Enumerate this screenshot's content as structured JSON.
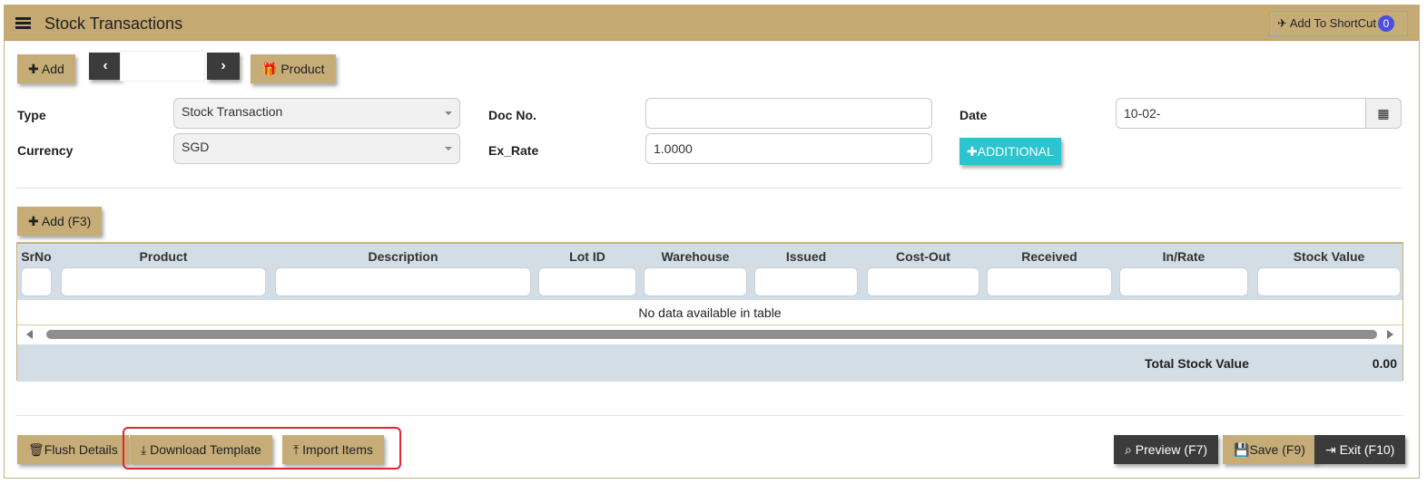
{
  "header": {
    "title": "Stock Transactions",
    "shortcut_label": "Add To ShortCut",
    "shortcut_count": "0"
  },
  "toolbar": {
    "add_label": "Add",
    "product_label": "Product",
    "nav_value": ""
  },
  "form": {
    "type_label": "Type",
    "type_value": "Stock Transaction",
    "currency_label": "Currency",
    "currency_value": "SGD",
    "doc_label": "Doc No.",
    "doc_value": "",
    "exrate_label": "Ex_Rate",
    "exrate_value": "1.0000",
    "date_label": "Date",
    "date_value": "10-02-",
    "additional_label": "ADDITIONAL"
  },
  "grid": {
    "add_label": "Add (F3)",
    "columns": [
      "SrNo",
      "Product",
      "Description",
      "Lot ID",
      "Warehouse",
      "Issued",
      "Cost-Out",
      "Received",
      "In/Rate",
      "Stock Value"
    ],
    "empty_message": "No data available in table",
    "total_label": "Total Stock Value",
    "total_value": "0.00"
  },
  "footer": {
    "flush_label": "Flush Details",
    "download_label": "Download Template",
    "import_label": "Import Items",
    "preview_label": "Preview (F7)",
    "save_label": "Save (F9)",
    "exit_label": "Exit (F10)"
  },
  "colors": {
    "accent": "#c4a973",
    "dark": "#3b3b3b",
    "teal": "#2cc4cf",
    "highlight": "#e0262e"
  }
}
